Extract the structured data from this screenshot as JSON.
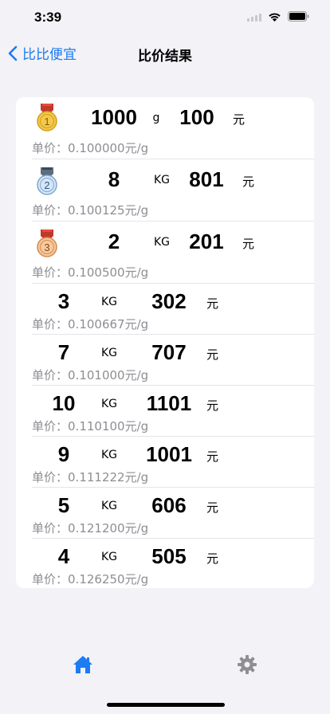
{
  "status": {
    "time": "3:39"
  },
  "nav": {
    "back_label": "比比便宜",
    "title": "比价结果"
  },
  "unit_price_prefix": "单价：",
  "results": [
    {
      "rank": 1,
      "quantity": "1000",
      "unit": "g",
      "price": "100",
      "currency": "元",
      "unit_price": "0.100000元/g",
      "medal": "gold-medal-icon"
    },
    {
      "rank": 2,
      "quantity": "8",
      "unit": "KG",
      "price": "801",
      "currency": "元",
      "unit_price": "0.100125元/g",
      "medal": "silver-medal-icon"
    },
    {
      "rank": 3,
      "quantity": "2",
      "unit": "KG",
      "price": "201",
      "currency": "元",
      "unit_price": "0.100500元/g",
      "medal": "bronze-medal-icon"
    },
    {
      "quantity": "3",
      "unit": "KG",
      "price": "302",
      "currency": "元",
      "unit_price": "0.100667元/g"
    },
    {
      "quantity": "7",
      "unit": "KG",
      "price": "707",
      "currency": "元",
      "unit_price": "0.101000元/g"
    },
    {
      "quantity": "10",
      "unit": "KG",
      "price": "1101",
      "currency": "元",
      "unit_price": "0.110100元/g"
    },
    {
      "quantity": "9",
      "unit": "KG",
      "price": "1001",
      "currency": "元",
      "unit_price": "0.111222元/g"
    },
    {
      "quantity": "5",
      "unit": "KG",
      "price": "606",
      "currency": "元",
      "unit_price": "0.121200元/g"
    },
    {
      "quantity": "4",
      "unit": "KG",
      "price": "505",
      "currency": "元",
      "unit_price": "0.126250元/g"
    }
  ],
  "tabs": [
    {
      "name": "home",
      "icon": "home-icon",
      "active": true
    },
    {
      "name": "settings",
      "icon": "gear-icon",
      "active": false
    }
  ],
  "colors": {
    "accent": "#1d7bf3",
    "gold": "#f2c94c",
    "silver": "#a9c7e8",
    "bronze": "#f0b27a",
    "secondary_text": "#8e8e93",
    "background": "#f2f2f7"
  }
}
